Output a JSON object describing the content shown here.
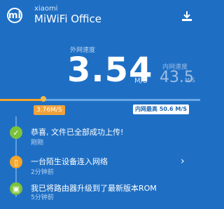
{
  "header": {
    "logo_glyph": "mi",
    "brand_top": "xiaomi",
    "brand_main": "MiWiFi Office",
    "download_icon": "download-icon"
  },
  "speed": {
    "outer_label": "外网速度",
    "value": "3.54",
    "unit": "M/S",
    "inner_label": "内网速度",
    "inner_value": "43.5",
    "inner_unit": "M/S"
  },
  "meter": {
    "outer_badge": "3.76M/S",
    "inner_badge": "内网最高 50.6 M/S",
    "progress": 0.22,
    "colors": {
      "track": "#6aa7e4",
      "fill": "#f4a52a",
      "badge_out": "#f0a23b"
    }
  },
  "feed": [
    {
      "icon": "check-icon",
      "icon_color": "#7cc23a",
      "title": "恭喜, 文件已全部成功上传!",
      "sub": "刚刚"
    },
    {
      "icon": "device-icon",
      "icon_color": "#f4a52a",
      "title": "一台陌生设备连入网络",
      "sub": "2分钟前"
    },
    {
      "icon": "router-icon",
      "icon_color": "#7cc23a",
      "title": "我已将路由器升级到了最新版本ROM",
      "sub": "5分钟前"
    }
  ],
  "colors": {
    "background": "#1e6fc4"
  }
}
